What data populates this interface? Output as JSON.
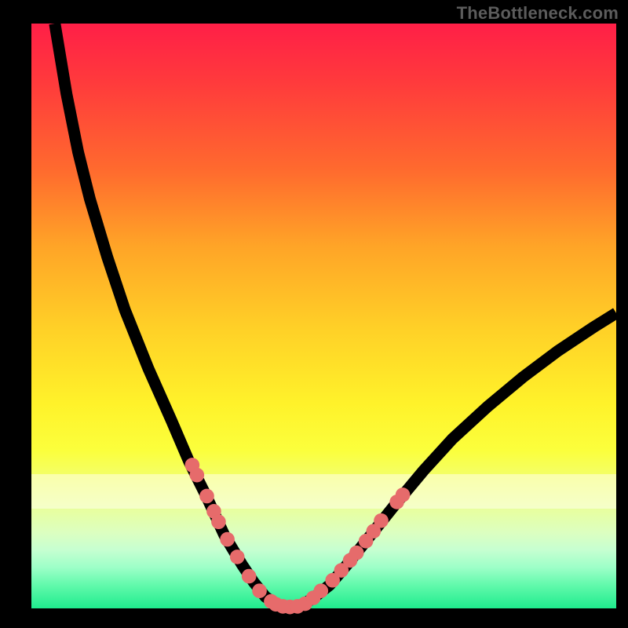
{
  "watermark": "TheBottleneck.com",
  "chart_data": {
    "type": "line",
    "title": "",
    "xlabel": "",
    "ylabel": "",
    "xlim": [
      0,
      100
    ],
    "ylim": [
      0,
      100
    ],
    "grid": false,
    "legend": false,
    "curve": [
      {
        "x": 4.0,
        "y": 100.0
      },
      {
        "x": 6.0,
        "y": 88.0
      },
      {
        "x": 8.0,
        "y": 78.0
      },
      {
        "x": 10.0,
        "y": 70.0
      },
      {
        "x": 13.0,
        "y": 60.0
      },
      {
        "x": 16.0,
        "y": 51.0
      },
      {
        "x": 20.0,
        "y": 41.0
      },
      {
        "x": 24.0,
        "y": 32.0
      },
      {
        "x": 27.0,
        "y": 25.0
      },
      {
        "x": 30.0,
        "y": 19.0
      },
      {
        "x": 33.0,
        "y": 12.5
      },
      {
        "x": 36.0,
        "y": 7.5
      },
      {
        "x": 38.0,
        "y": 4.5
      },
      {
        "x": 40.0,
        "y": 2.0
      },
      {
        "x": 42.0,
        "y": 0.6
      },
      {
        "x": 44.0,
        "y": 0.2
      },
      {
        "x": 46.0,
        "y": 0.5
      },
      {
        "x": 48.0,
        "y": 1.6
      },
      {
        "x": 51.0,
        "y": 4.0
      },
      {
        "x": 54.0,
        "y": 7.5
      },
      {
        "x": 58.0,
        "y": 12.5
      },
      {
        "x": 62.0,
        "y": 17.5
      },
      {
        "x": 67.0,
        "y": 23.5
      },
      {
        "x": 72.0,
        "y": 29.0
      },
      {
        "x": 78.0,
        "y": 34.5
      },
      {
        "x": 84.0,
        "y": 39.5
      },
      {
        "x": 90.0,
        "y": 44.0
      },
      {
        "x": 96.0,
        "y": 48.0
      },
      {
        "x": 100.0,
        "y": 50.5
      }
    ],
    "dots": [
      {
        "x": 27.5,
        "y": 24.5
      },
      {
        "x": 28.3,
        "y": 22.8
      },
      {
        "x": 30.0,
        "y": 19.2
      },
      {
        "x": 31.2,
        "y": 16.6
      },
      {
        "x": 32.0,
        "y": 14.8
      },
      {
        "x": 33.5,
        "y": 11.8
      },
      {
        "x": 35.2,
        "y": 8.8
      },
      {
        "x": 37.2,
        "y": 5.5
      },
      {
        "x": 39.0,
        "y": 3.0
      },
      {
        "x": 41.0,
        "y": 1.2
      },
      {
        "x": 41.8,
        "y": 0.7
      },
      {
        "x": 43.0,
        "y": 0.35
      },
      {
        "x": 44.2,
        "y": 0.25
      },
      {
        "x": 45.5,
        "y": 0.35
      },
      {
        "x": 46.8,
        "y": 0.8
      },
      {
        "x": 48.2,
        "y": 1.8
      },
      {
        "x": 49.5,
        "y": 3.0
      },
      {
        "x": 51.5,
        "y": 4.8
      },
      {
        "x": 53.0,
        "y": 6.5
      },
      {
        "x": 54.5,
        "y": 8.2
      },
      {
        "x": 55.6,
        "y": 9.5
      },
      {
        "x": 57.2,
        "y": 11.5
      },
      {
        "x": 58.5,
        "y": 13.2
      },
      {
        "x": 59.8,
        "y": 15.0
      },
      {
        "x": 62.5,
        "y": 18.2
      },
      {
        "x": 63.5,
        "y": 19.4
      }
    ],
    "background_gradient": {
      "top": "#ff1f47",
      "upper_mid": "#ffa427",
      "mid": "#fff22a",
      "lower_mid": "#dcffc0",
      "bottom": "#1fec8d"
    }
  }
}
